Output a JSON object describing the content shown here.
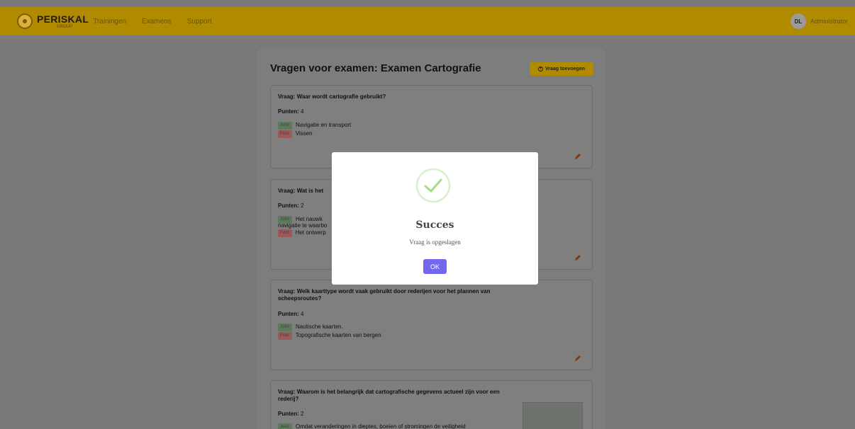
{
  "app": {
    "brand": "PERISKAL",
    "brand_sub": "GROUP",
    "nav": [
      "Trainingen",
      "Examens",
      "Support"
    ],
    "user_initials": "DL",
    "user_name": "Administrator"
  },
  "page": {
    "title": "Vragen voor examen: Examen Cartografie",
    "add_button": "Vraag toevoegen"
  },
  "labels": {
    "question_prefix": "Vraag:",
    "points_prefix": "Punten:",
    "correct": "Juist:",
    "wrong": "Fout:"
  },
  "questions": [
    {
      "text": "Waar wordt cartografie gebruikt?",
      "points": "4",
      "correct": "Navigatie en transport",
      "wrong": "Vissen"
    },
    {
      "text": "Wat is het",
      "points": "2",
      "correct": "Het nauwk",
      "correct_line2": "navigatie te waarbo",
      "wrong": "Het ontwerp"
    },
    {
      "text": "Welk kaarttype wordt vaak gebruikt door rederijen voor het plannen van scheepsroutes?",
      "points": "4",
      "correct": "Nautische kaarten.",
      "wrong": "Topografische kaarten van bergen"
    },
    {
      "text": "Waarom is het belangrijk dat cartografische gegevens actueel zijn voor een rederij?",
      "points": "2",
      "correct": "Omdat veranderingen in dieptes, boeien of stromingen de veiligheid"
    }
  ],
  "modal": {
    "title": "Succes",
    "message": "Vraag is opgeslagen",
    "ok_label": "OK"
  },
  "colors": {
    "accent": "#f5c200",
    "modal_button": "#7367f0",
    "success": "#a5dc86"
  }
}
